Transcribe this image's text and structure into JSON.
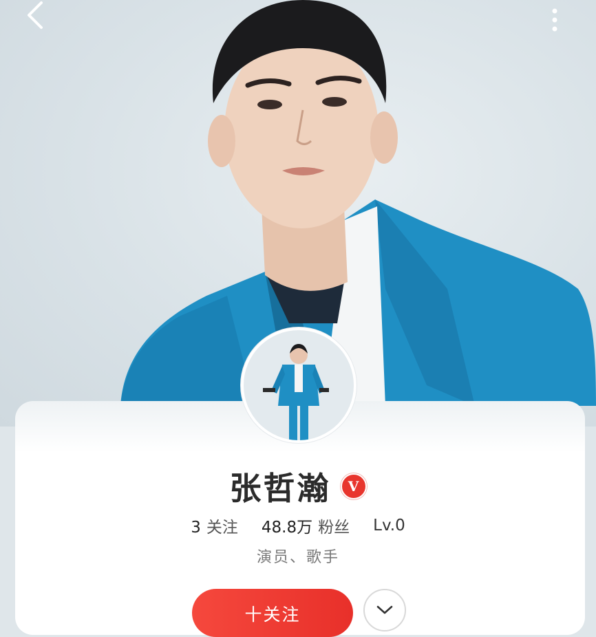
{
  "profile": {
    "name": "张哲瀚",
    "verified_badge": "V",
    "following_count": "3",
    "following_label": "关注",
    "followers_count": "48.8万",
    "followers_label": "粉丝",
    "level": "Lv.0",
    "bio": "演员、歌手"
  },
  "actions": {
    "follow_label": "十关注"
  },
  "icons": {
    "back": "chevron-left-icon",
    "more": "more-vertical-icon",
    "expand": "chevron-down-icon"
  },
  "colors": {
    "accent": "#e8352d",
    "jacket": "#1f8fc4"
  }
}
